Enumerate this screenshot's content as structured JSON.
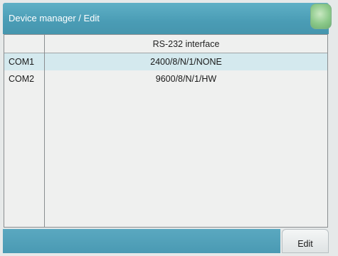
{
  "titlebar": {
    "title": "Device manager / Edit"
  },
  "table": {
    "header": "RS-232 interface",
    "rows": [
      {
        "name": "COM1",
        "value": "2400/8/N/1/NONE",
        "selected": true
      },
      {
        "name": "COM2",
        "value": "9600/8/N/1/HW",
        "selected": false
      }
    ]
  },
  "footer": {
    "edit_label": "Edit"
  },
  "colors": {
    "titlebar": "#4a9cb5",
    "selected_row": "#d4e9ee",
    "corner_button": "#8cc98a"
  }
}
